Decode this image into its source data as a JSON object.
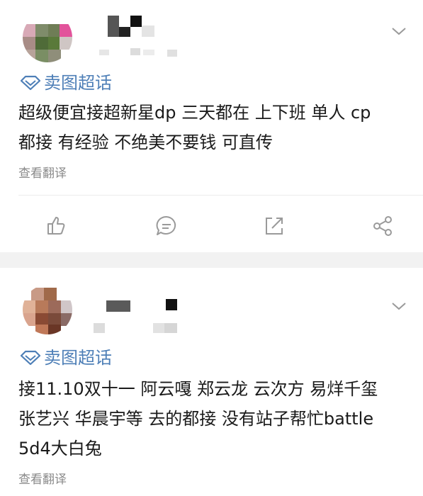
{
  "posts": [
    {
      "topic_icon": "diamond-topic-icon",
      "topic_label": "卖图超话",
      "content_lines": [
        "超级便宜接超新星dp 三天都在 上下班 单人 cp",
        "都接 有经验 不绝美不要钱 可直传"
      ],
      "translate_label": "查看翻译",
      "actions": [
        "like-icon",
        "comment-icon",
        "share-icon",
        "forward-icon"
      ]
    },
    {
      "topic_icon": "diamond-topic-icon",
      "topic_label": "卖图超话",
      "content_lines": [
        "接11.10双十一 阿云嘎 郑云龙 云次方 易烊千玺",
        "张艺兴 华晨宇等 去的都接 没有站子帮忙battle",
        "5d4大白兔"
      ],
      "translate_label": "查看翻译"
    }
  ],
  "colors": {
    "topic_blue": "#4e7fb7",
    "text": "#1a1a1a",
    "muted": "#8a8a8a",
    "separator": "#f2f2f2",
    "icon_gray": "#9a9a9a"
  }
}
